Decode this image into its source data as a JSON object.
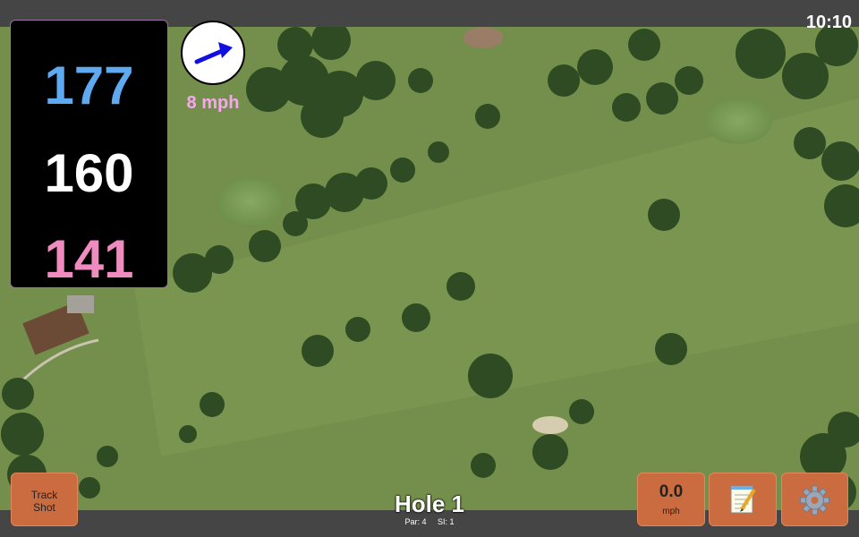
{
  "status_bar": {
    "time": "10:10"
  },
  "distances": {
    "back": "177",
    "middle": "160",
    "front": "141"
  },
  "wind": {
    "speed": "8 mph",
    "icon": "arrow-right-icon",
    "arrow_color": "#1010e0"
  },
  "buttons": {
    "track_shot": {
      "line1": "Track",
      "line2": "Shot"
    },
    "speed": {
      "value": "0.0",
      "unit": "mph"
    },
    "notes_icon": "notepad-icon",
    "settings_icon": "gear-icon"
  },
  "hole": {
    "title": "Hole 1",
    "par": "Par: 4",
    "si": "SI: 1"
  },
  "colors": {
    "accent_button": "#cb6b40",
    "back_distance": "#5fa9f0",
    "front_distance": "#f08bc0",
    "wind_text": "#f6a7f0"
  }
}
